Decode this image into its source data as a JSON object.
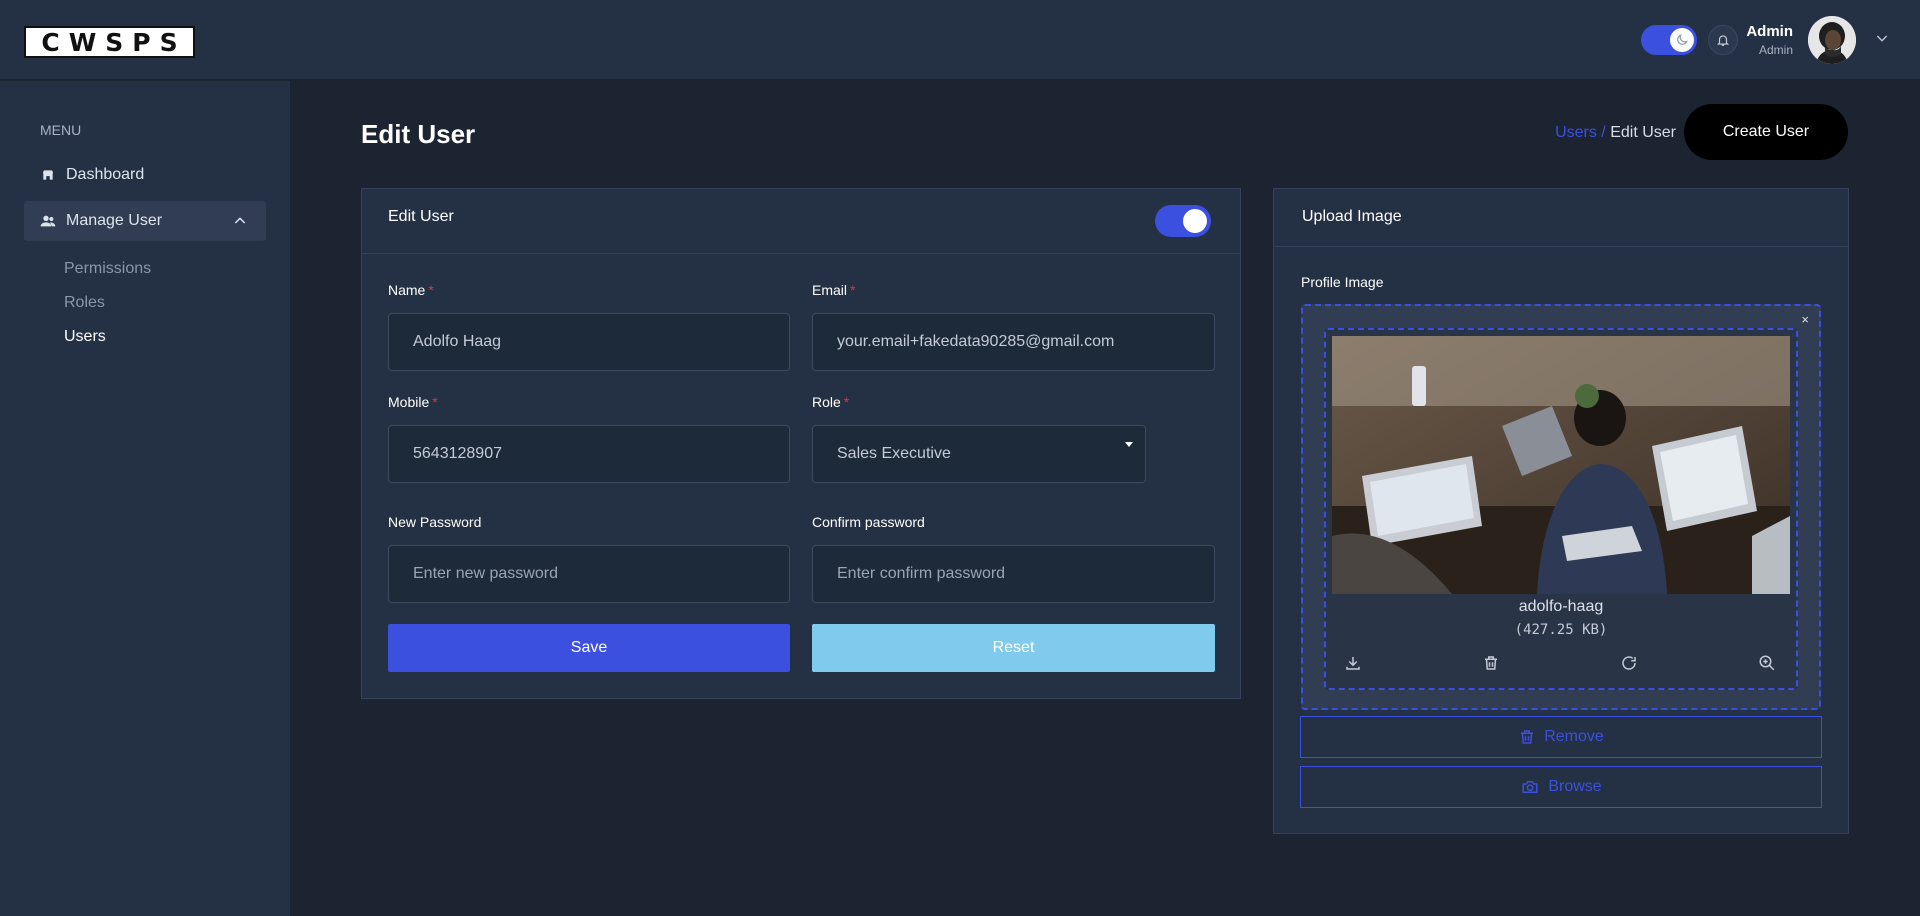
{
  "header": {
    "logo_text": "CWSPS",
    "user": {
      "name": "Admin",
      "role": "Admin"
    }
  },
  "sidebar": {
    "menu_label": "MENU",
    "items": [
      {
        "label": "Dashboard",
        "icon": "store-icon"
      },
      {
        "label": "Manage User",
        "icon": "users-icon",
        "expanded": true,
        "children": [
          {
            "label": "Permissions"
          },
          {
            "label": "Roles"
          },
          {
            "label": "Users",
            "current": true
          }
        ]
      }
    ]
  },
  "page": {
    "title": "Edit User",
    "breadcrumb": {
      "parent": "Users /",
      "current": "Edit User"
    },
    "create_button": "Create User"
  },
  "form": {
    "card_title": "Edit User",
    "status_enabled": true,
    "name": {
      "label": "Name",
      "required": "*",
      "value": "Adolfo Haag"
    },
    "email": {
      "label": "Email",
      "required": "*",
      "value": "your.email+fakedata90285@gmail.com"
    },
    "mobile": {
      "label": "Mobile",
      "required": "*",
      "value": "5643128907"
    },
    "role": {
      "label": "Role",
      "required": "*",
      "value": "Sales Executive"
    },
    "new_password": {
      "label": "New Password",
      "placeholder": "Enter new password"
    },
    "confirm_password": {
      "label": "Confirm password",
      "placeholder": "Enter confirm password"
    },
    "save_label": "Save",
    "reset_label": "Reset"
  },
  "upload": {
    "card_title": "Upload Image",
    "field_label": "Profile Image",
    "close_glyph": "×",
    "file_name": "adolfo-haag",
    "file_size": "(427.25 KB)",
    "remove_label": "Remove",
    "browse_label": "Browse"
  },
  "colors": {
    "accent": "#3c50e0",
    "reset": "#80caee",
    "header_bg": "#243044",
    "body_bg": "#1c2331"
  }
}
